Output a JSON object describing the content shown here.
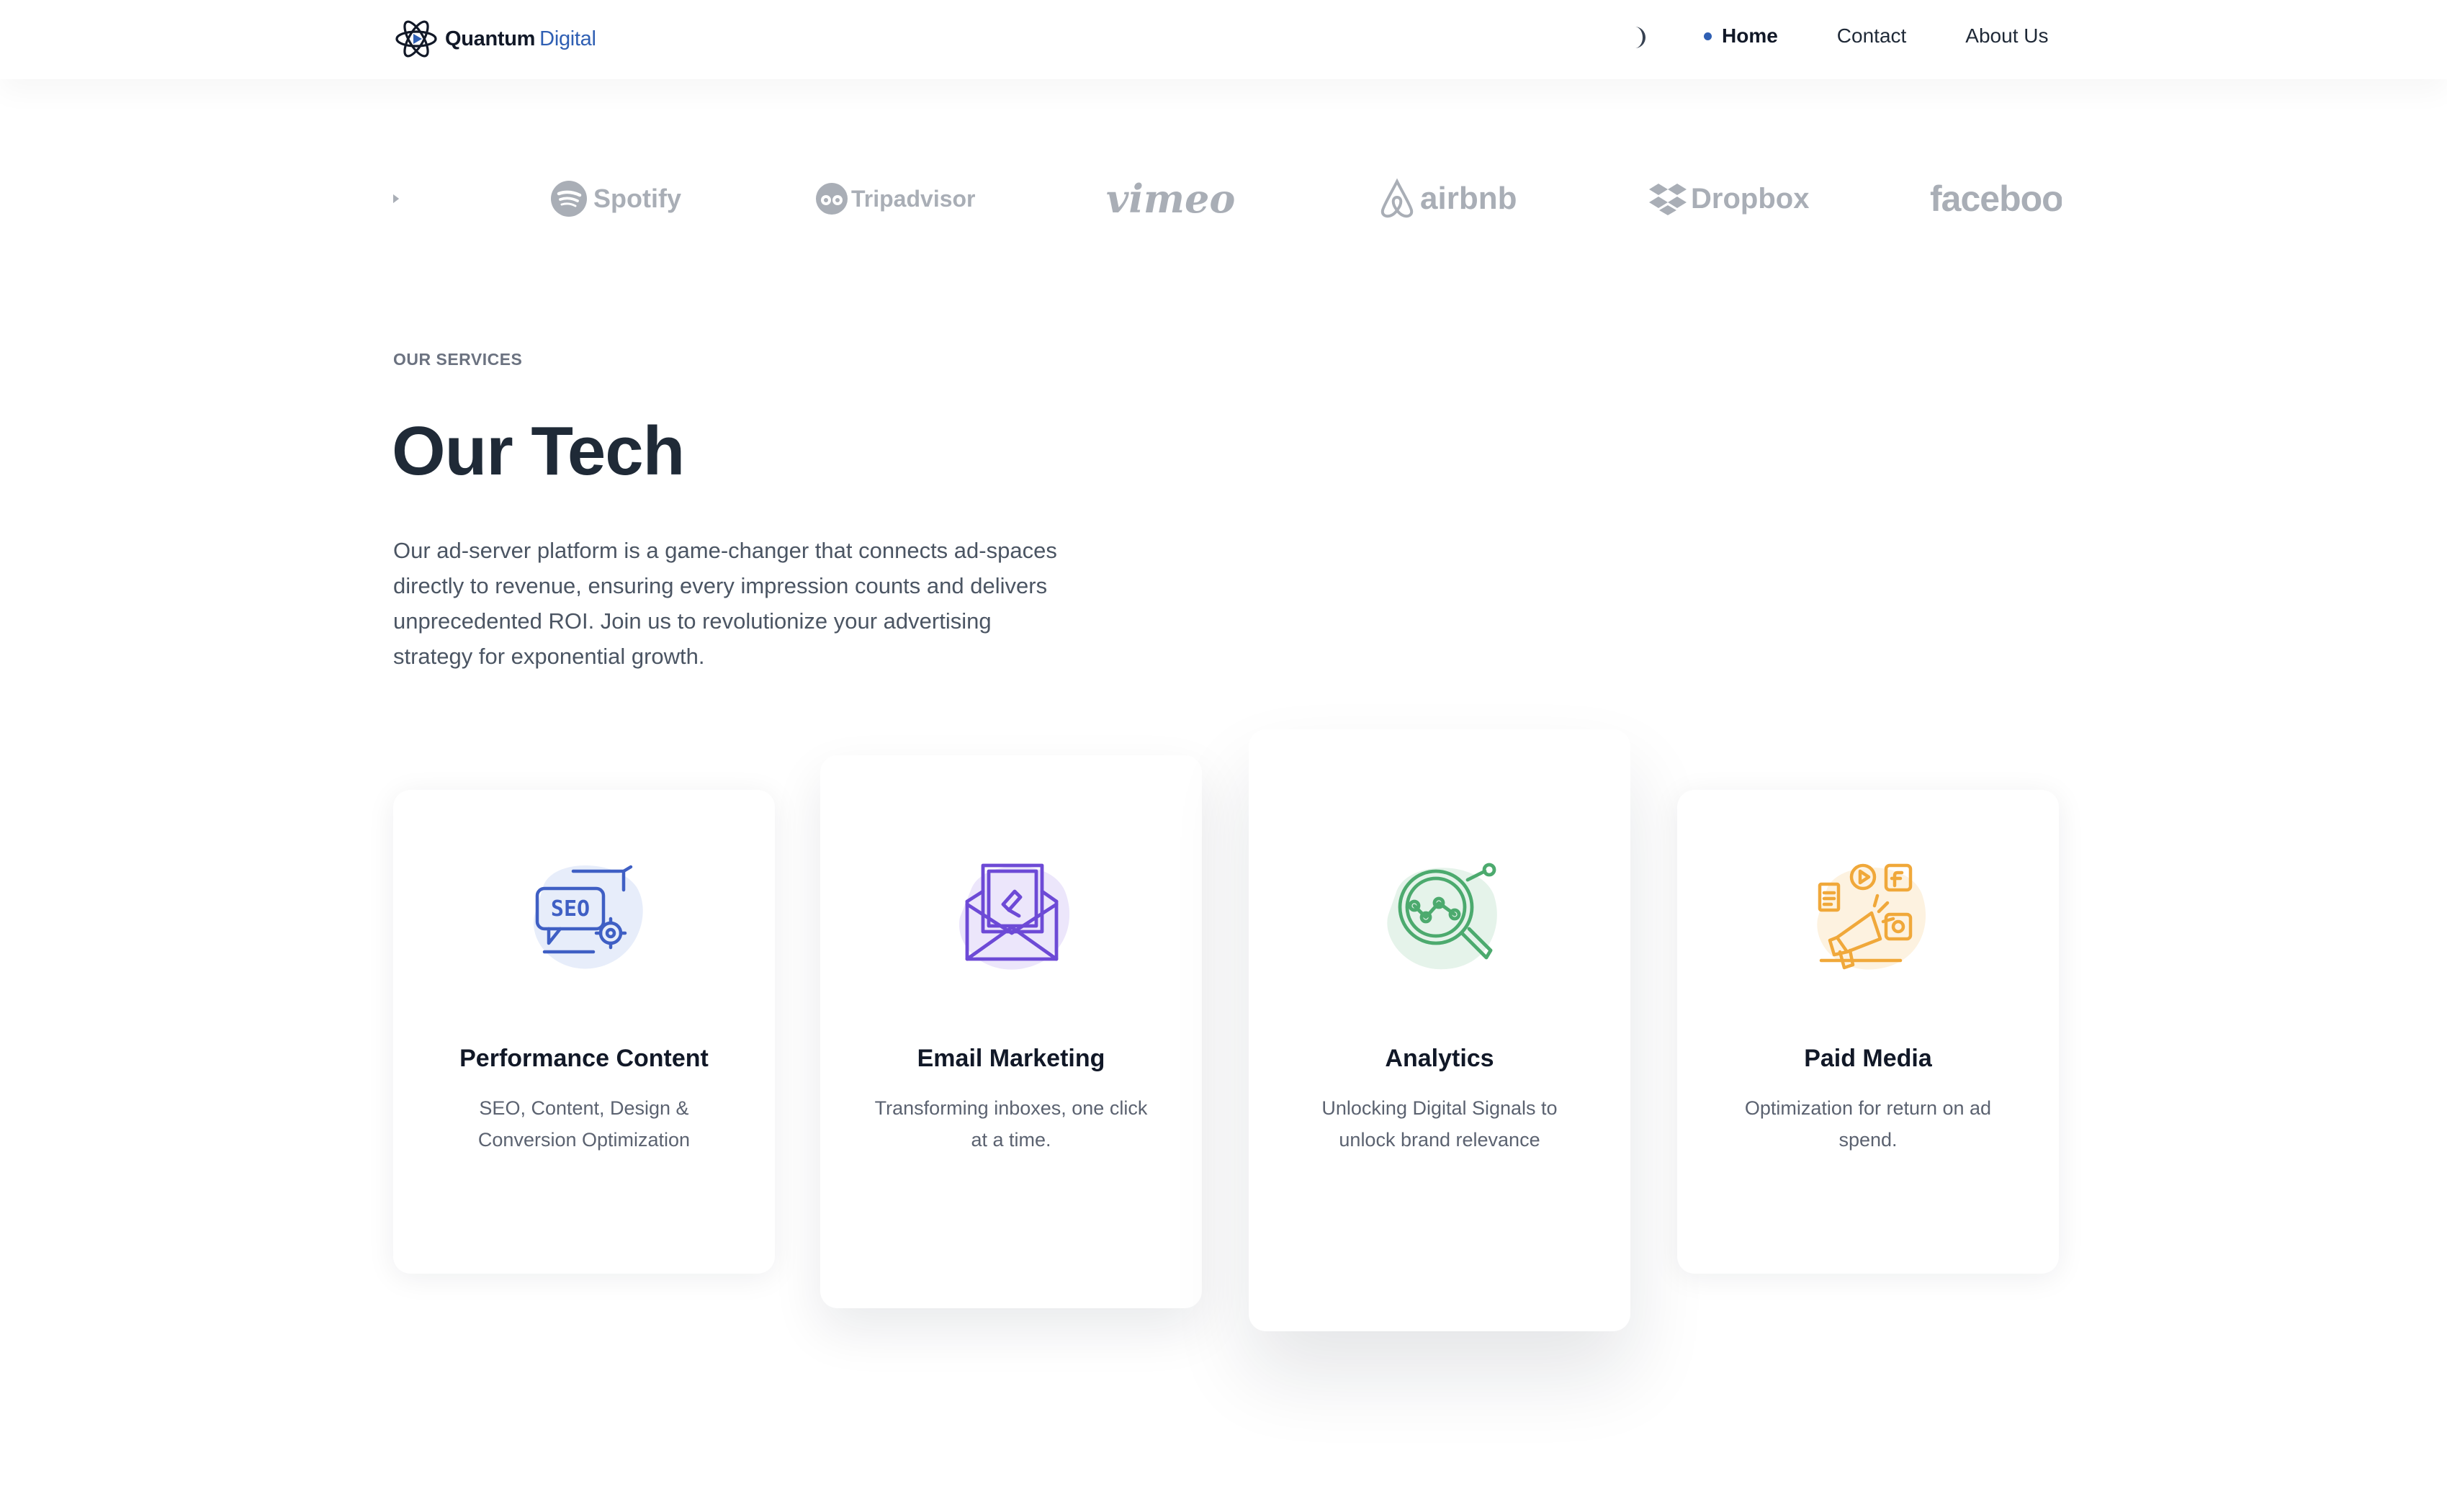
{
  "header": {
    "logo_primary": "Quantum",
    "logo_accent": "Digital",
    "nav": [
      {
        "label": "Home",
        "active": true
      },
      {
        "label": "Contact",
        "active": false
      },
      {
        "label": "About Us",
        "active": false
      }
    ]
  },
  "brands": [
    "Spotify",
    "Tripadvisor",
    "vimeo",
    "airbnb",
    "Dropbox",
    "facebook"
  ],
  "services": {
    "eyebrow": "OUR SERVICES",
    "title": "Our Tech",
    "description": "Our ad-server platform is a game-changer that connects ad-spaces directly to revenue, ensuring every impression counts and delivers unprecedented ROI. Join us to revolutionize your advertising strategy for exponential growth.",
    "cards": [
      {
        "title": "Performance Content",
        "description": "SEO, Content, Design & Conversion Optimization",
        "icon": "seo-icon",
        "icon_text": "SEO",
        "color": "#3f5fc4"
      },
      {
        "title": "Email Marketing",
        "description": "Transforming inboxes, one click at a time.",
        "icon": "email-icon",
        "color": "#6d4ad6"
      },
      {
        "title": "Analytics",
        "description": "Unlocking Digital Signals to unlock brand relevance",
        "icon": "analytics-icon",
        "color": "#4caa6e"
      },
      {
        "title": "Paid Media",
        "description": "Optimization for return on ad spend.",
        "icon": "megaphone-icon",
        "color": "#f0a83a"
      }
    ]
  },
  "colors": {
    "accent": "#2f5fb3",
    "brand_logo_gray": "#a9aeb6",
    "title": "#1f2a37"
  }
}
